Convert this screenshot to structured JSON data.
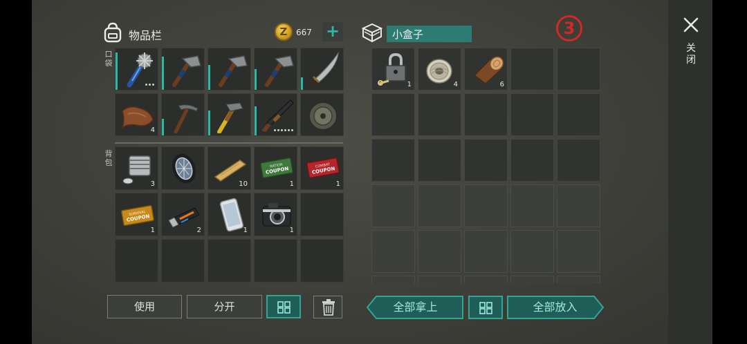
{
  "inventory": {
    "title": "物品栏",
    "coins": "667",
    "pocket_label": "口袋",
    "backpack_label": "背包",
    "pocket_items": [
      {
        "name": "spiked-club-icon",
        "qty": "",
        "durability": 90,
        "dots": 3
      },
      {
        "name": "hatchet-icon",
        "qty": "",
        "durability": 80,
        "dots": 0
      },
      {
        "name": "hatchet-icon",
        "qty": "",
        "durability": 60,
        "dots": 0
      },
      {
        "name": "hatchet-icon",
        "qty": "",
        "durability": 50,
        "dots": 0
      },
      {
        "name": "machete-icon",
        "qty": "",
        "durability": 30,
        "dots": 0
      },
      {
        "name": "leather-icon",
        "qty": "4",
        "durability": 0,
        "dots": 0
      },
      {
        "name": "pickaxe-icon",
        "qty": "",
        "durability": 40,
        "dots": 0
      },
      {
        "name": "hammer-icon",
        "qty": "",
        "durability": 60,
        "dots": 0
      },
      {
        "name": "shotgun-icon",
        "qty": "",
        "durability": 70,
        "dots": 6
      },
      {
        "name": "disc-icon",
        "qty": "",
        "durability": 0,
        "dots": 0
      }
    ],
    "backpack_items": [
      {
        "name": "engine-part-icon",
        "qty": "3"
      },
      {
        "name": "wheel-icon",
        "qty": ""
      },
      {
        "name": "wood-plank-icon",
        "qty": "10"
      },
      {
        "name": "ration-coupon-icon",
        "qty": "1"
      },
      {
        "name": "combat-coupon-icon",
        "qty": "1"
      },
      {
        "name": "survival-coupon-icon",
        "qty": "1"
      },
      {
        "name": "usb-drive-icon",
        "qty": "2"
      },
      {
        "name": "smartphone-icon",
        "qty": "1"
      },
      {
        "name": "camera-icon",
        "qty": "1"
      },
      {
        "name": "",
        "qty": ""
      },
      {
        "name": "",
        "qty": ""
      },
      {
        "name": "",
        "qty": ""
      },
      {
        "name": "",
        "qty": ""
      },
      {
        "name": "",
        "qty": ""
      },
      {
        "name": "",
        "qty": ""
      }
    ],
    "coupon_text": {
      "ration": "RATION",
      "combat": "COMBAT",
      "coupon": "COUPON",
      "survival": "SURVIVAL"
    },
    "buttons": {
      "use": "使用",
      "split": "分开"
    }
  },
  "container": {
    "title": "小盒子",
    "items": [
      {
        "name": "padlock-icon",
        "qty": "1"
      },
      {
        "name": "wire-spool-icon",
        "qty": "4"
      },
      {
        "name": "log-icon",
        "qty": "6"
      }
    ],
    "buttons": {
      "take_all": "全部拿上",
      "put_all": "全部放入"
    }
  },
  "badge": "③",
  "close_label": "关闭",
  "colors": {
    "accent": "#2bb9a3",
    "title_bg": "#2d7c73",
    "badge": "#d32828"
  }
}
